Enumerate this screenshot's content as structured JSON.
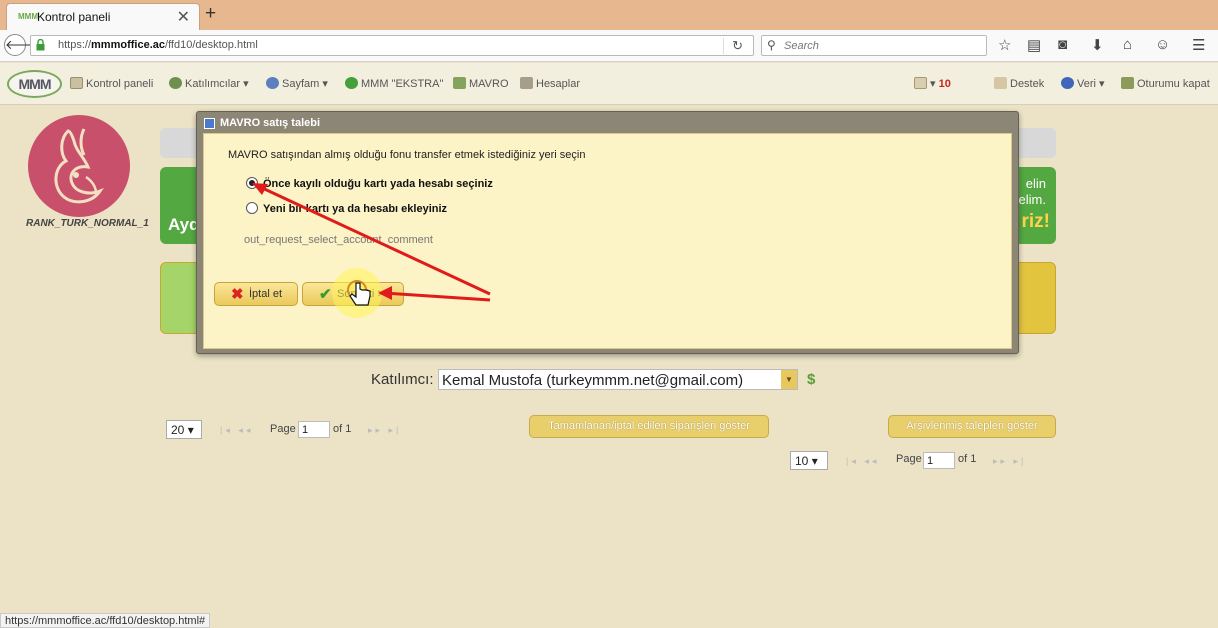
{
  "browser": {
    "tab_title": "Kontrol paneli",
    "tab_favicon_text": "MMM",
    "url_prefix": "https://",
    "url_host": "mmmoffice.ac",
    "url_path": "/ffd10/desktop.html",
    "search_placeholder": "Search",
    "status_url": "https://mmmoffice.ac/ffd10/desktop.html#"
  },
  "toolbar": {
    "logo_text": "MMM",
    "items": [
      {
        "label": "Kontrol paneli"
      },
      {
        "label": "Katılımcılar"
      },
      {
        "label": "Sayfam"
      },
      {
        "label": "MMM \"EKSTRA\""
      },
      {
        "label": "MAVRO"
      },
      {
        "label": "Hesaplar"
      }
    ],
    "notification_count": "10",
    "right_items": [
      {
        "label": "Destek"
      },
      {
        "label": "Veri"
      },
      {
        "label": "Oturumu kapat"
      }
    ]
  },
  "profile": {
    "rank": "RANK_TURK_NORMAL_1"
  },
  "banner": {
    "left_text": "Ayd",
    "right_line1": "elin",
    "right_line2": "elim.",
    "right_line3": "riz!"
  },
  "participant": {
    "label": "Katılımcı:",
    "value": "Kemal Mustofa (turkeymmm.net@gmail.com)"
  },
  "orders_pager": {
    "per_page": "20",
    "page_label": "Page",
    "page_value": "1",
    "of_label": "of 1",
    "show_completed_button": "Tamamlanan/iptal edilen siparişleri göster"
  },
  "requests_pager": {
    "per_page": "10",
    "page_label": "Page",
    "page_value": "1",
    "of_label": "of 1",
    "show_archived_button": "Arşivlenmiş talepleri göster"
  },
  "modal": {
    "title": "MAVRO satış talebi",
    "instruction": "MAVRO satışından almış olduğu fonu transfer etmek istediğiniz yeri seçin",
    "option_existing": "Önce kayılı olduğu kartı yada hesabı seçiniz",
    "option_new": "Yeni bir kartı ya da hesabı ekleyiniz",
    "comment": "out_request_select_account_comment",
    "cancel_label": "İptal et",
    "next_label": "Sonraki >"
  },
  "colors": {
    "accent_green": "#54a842",
    "accent_yellow": "#e2c43f",
    "annotation_red": "#e01b1b"
  }
}
